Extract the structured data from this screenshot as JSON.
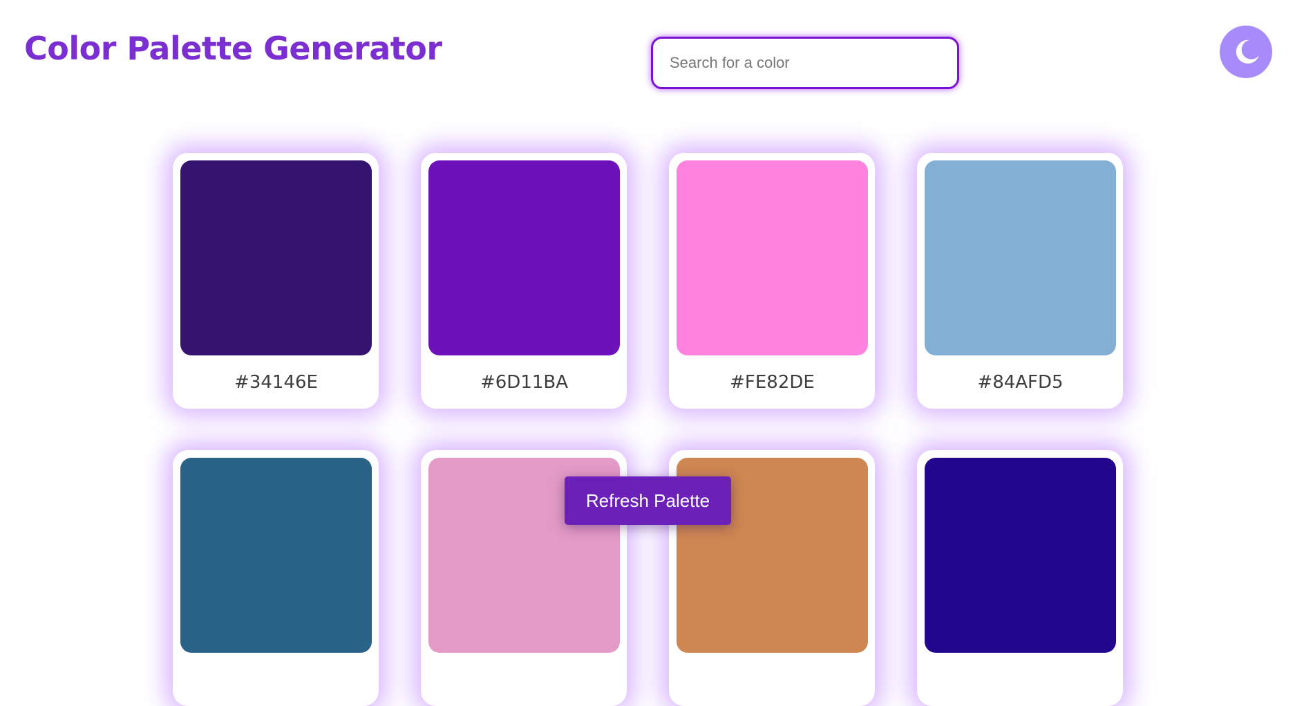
{
  "header": {
    "title": "Color Palette Generator",
    "search_placeholder": "Search for a color",
    "theme_toggle_icon": "moon-icon"
  },
  "palette": [
    {
      "hex": "#34146E",
      "color": "#34146E"
    },
    {
      "hex": "#6D11BA",
      "color": "#6D11BA"
    },
    {
      "hex": "#FE82DE",
      "color": "#FE82DE"
    },
    {
      "hex": "#84AFD5",
      "color": "#84AFD5"
    },
    {
      "hex": "",
      "color": "#2A6288"
    },
    {
      "hex": "",
      "color": "#E39BC6"
    },
    {
      "hex": "",
      "color": "#CE8751"
    },
    {
      "hex": "",
      "color": "#22078E"
    }
  ],
  "actions": {
    "refresh_label": "Refresh Palette"
  },
  "colors": {
    "accent": "#7B2FD0",
    "search_border": "#7A12D4",
    "toggle_bg": "#A78BFA",
    "button_bg": "#6B21B8",
    "card_glow": "#BE82FF"
  }
}
